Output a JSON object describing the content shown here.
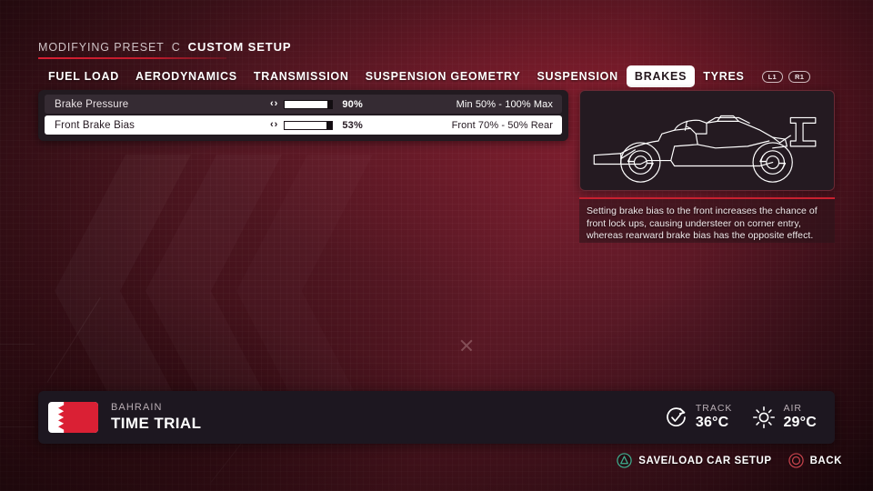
{
  "header": {
    "modifying_label": "MODIFYING PRESET",
    "separator": "C",
    "preset_name": "CUSTOM SETUP"
  },
  "tabs": [
    {
      "label": "FUEL LOAD",
      "active": false
    },
    {
      "label": "AERODYNAMICS",
      "active": false
    },
    {
      "label": "TRANSMISSION",
      "active": false
    },
    {
      "label": "SUSPENSION GEOMETRY",
      "active": false
    },
    {
      "label": "SUSPENSION",
      "active": false
    },
    {
      "label": "BRAKES",
      "active": true
    },
    {
      "label": "TYRES",
      "active": false
    }
  ],
  "shoulder_buttons": [
    {
      "label": "L1",
      "icon": "shoulder-button-l1-icon"
    },
    {
      "label": "R1",
      "icon": "shoulder-button-r1-icon"
    }
  ],
  "settings": {
    "rows": [
      {
        "label": "Brake Pressure",
        "value_text": "90%",
        "fill_percent": 90,
        "range_text": "Min 50% - 100% Max",
        "selected": false,
        "left_arrow": "‹",
        "right_arrow": "›"
      },
      {
        "label": "Front Brake Bias",
        "value_text": "53%",
        "fill_percent": 88,
        "range_text": "Front 70% - 50% Rear",
        "selected": true,
        "left_arrow": "‹",
        "right_arrow": "›"
      }
    ]
  },
  "car_preview": {
    "icon": "f1-car-side-profile-icon",
    "alt": "Formula 1 car side profile outline"
  },
  "description": {
    "text": "Setting brake bias to the front increases the chance of front lock ups, causing understeer on corner entry, whereas rearward brake bias has the opposite effect."
  },
  "bottom_bar": {
    "flag_icon": "bahrain-flag-icon",
    "country": "BAHRAIN",
    "mode": "TIME TRIAL",
    "weather": [
      {
        "label": "TRACK",
        "value": "36°C",
        "icon": "track-temperature-icon"
      },
      {
        "label": "AIR",
        "value": "29°C",
        "icon": "air-temperature-sun-icon"
      }
    ]
  },
  "prompts": [
    {
      "button": "triangle",
      "icon": "playstation-triangle-icon",
      "label": "SAVE/LOAD CAR SETUP"
    },
    {
      "button": "circle",
      "icon": "playstation-circle-icon",
      "label": "BACK"
    }
  ],
  "colors": {
    "accent_red": "#c9202f",
    "background_red": "#5b1a26",
    "panel_dark": "#221a20",
    "selected_white": "#ffffff",
    "triangle_green": "#3fae8f",
    "circle_red": "#c8434c",
    "flag_red": "#da2034"
  }
}
